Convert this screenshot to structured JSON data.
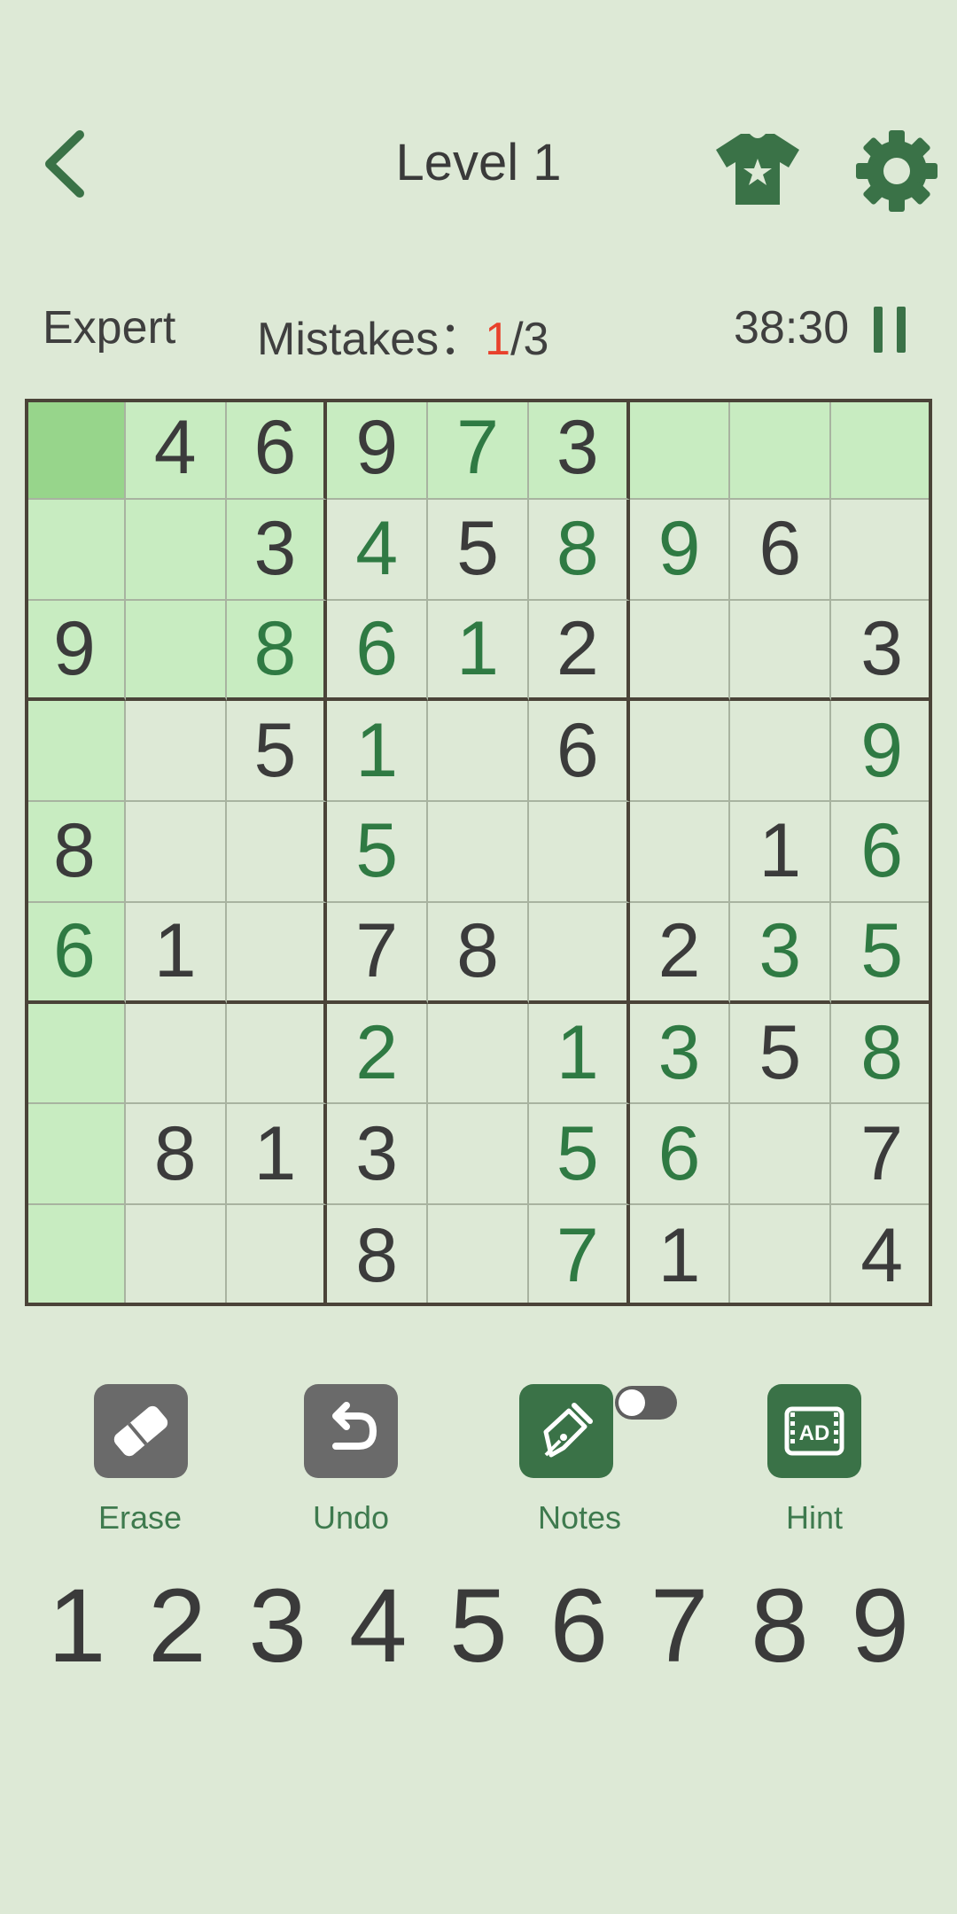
{
  "header": {
    "title": "Level 1"
  },
  "status": {
    "difficulty": "Expert",
    "mistakes_label": "Mistakes：",
    "mistakes_current": "1",
    "mistakes_max": "/3",
    "timer": "38:30"
  },
  "colors": {
    "accent": "#3a7247",
    "highlight": "#c8ecc1",
    "selected": "#97d58b",
    "mistake": "#e8412c"
  },
  "board": {
    "rows": [
      [
        "",
        "4",
        "6",
        "9",
        "7",
        "3",
        "",
        "",
        ""
      ],
      [
        "",
        "",
        "3",
        "4",
        "5",
        "8",
        "9",
        "6",
        ""
      ],
      [
        "9",
        "",
        "8",
        "6",
        "1",
        "2",
        "",
        "",
        "3"
      ],
      [
        "",
        "",
        "5",
        "1",
        "",
        "6",
        "",
        "",
        "9"
      ],
      [
        "8",
        "",
        "",
        "5",
        "",
        "",
        "",
        "1",
        "6"
      ],
      [
        "6",
        "1",
        "",
        "7",
        "8",
        "",
        "2",
        "3",
        "5"
      ],
      [
        "",
        "",
        "",
        "2",
        "",
        "1",
        "3",
        "5",
        "8"
      ],
      [
        "",
        "8",
        "1",
        "3",
        "",
        "5",
        "6",
        "",
        "7"
      ],
      [
        "",
        "",
        "",
        "8",
        "",
        "7",
        "1",
        "",
        "4"
      ]
    ],
    "user_entered": [
      [
        0,
        0,
        0,
        0,
        1,
        0,
        0,
        0,
        0
      ],
      [
        0,
        0,
        0,
        1,
        0,
        1,
        1,
        0,
        0
      ],
      [
        0,
        0,
        1,
        1,
        1,
        0,
        0,
        0,
        0
      ],
      [
        0,
        0,
        0,
        1,
        0,
        0,
        0,
        0,
        1
      ],
      [
        0,
        0,
        0,
        1,
        0,
        0,
        0,
        0,
        1
      ],
      [
        1,
        0,
        0,
        0,
        0,
        0,
        0,
        1,
        1
      ],
      [
        0,
        0,
        0,
        1,
        0,
        1,
        1,
        0,
        1
      ],
      [
        0,
        0,
        0,
        0,
        0,
        1,
        1,
        0,
        0
      ],
      [
        0,
        0,
        0,
        0,
        0,
        1,
        0,
        0,
        0
      ]
    ],
    "selected": [
      0,
      0
    ]
  },
  "tools": {
    "erase": "Erase",
    "undo": "Undo",
    "notes": "Notes",
    "hint": "Hint",
    "hint_badge": "AD"
  },
  "numpad": [
    "1",
    "2",
    "3",
    "4",
    "5",
    "6",
    "7",
    "8",
    "9"
  ]
}
